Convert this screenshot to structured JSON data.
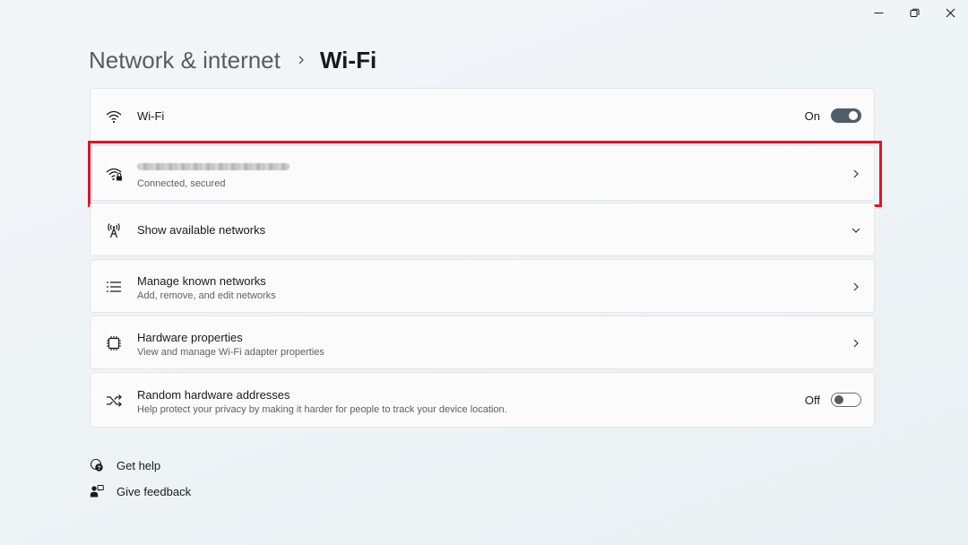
{
  "window": {
    "controls": [
      "minimize-icon",
      "restore-icon",
      "close-icon"
    ]
  },
  "breadcrumb": {
    "parent": "Network & internet",
    "separator_icon": "chevron-right-icon",
    "current": "Wi-Fi"
  },
  "wifi_toggle": {
    "icon": "wifi-icon",
    "label": "Wi-Fi",
    "state_label": "On",
    "is_on": true
  },
  "current_network": {
    "icon": "wifi-secured-icon",
    "name_obscured": true,
    "status": "Connected, secured",
    "highlight_color": "#e81123"
  },
  "show_networks": {
    "icon": "antenna-icon",
    "label": "Show available networks",
    "expander_icon": "chevron-down-icon"
  },
  "manage_known": {
    "icon": "list-icon",
    "label": "Manage known networks",
    "description": "Add, remove, and edit networks"
  },
  "hardware_properties": {
    "icon": "chip-icon",
    "label": "Hardware properties",
    "description": "View and manage Wi-Fi adapter properties"
  },
  "random_hw": {
    "icon": "shuffle-icon",
    "label": "Random hardware addresses",
    "description": "Help protect your privacy by making it harder for people to track your device location.",
    "state_label": "Off",
    "is_on": false
  },
  "footer_links": {
    "get_help": "Get help",
    "give_feedback": "Give feedback"
  },
  "colors": {
    "toggle_on": "#4e5d6a",
    "accent_highlight": "#e81123"
  }
}
